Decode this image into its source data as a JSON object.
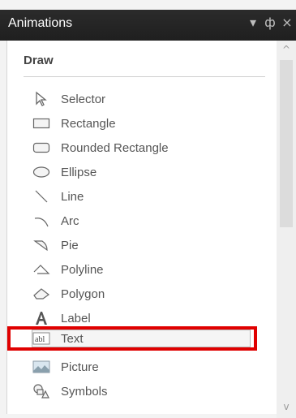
{
  "window": {
    "title": "Animations",
    "controls": {
      "dropdown": "▾",
      "pin": "ф",
      "close": "×"
    }
  },
  "section": {
    "title": "Draw"
  },
  "items": [
    {
      "label": "Selector",
      "icon": "cursor-arrow-icon"
    },
    {
      "label": "Rectangle",
      "icon": "rectangle-icon"
    },
    {
      "label": "Rounded Rectangle",
      "icon": "rounded-rectangle-icon"
    },
    {
      "label": "Ellipse",
      "icon": "ellipse-icon"
    },
    {
      "label": "Line",
      "icon": "line-icon"
    },
    {
      "label": "Arc",
      "icon": "arc-icon"
    },
    {
      "label": "Pie",
      "icon": "pie-icon"
    },
    {
      "label": "Polyline",
      "icon": "polyline-icon"
    },
    {
      "label": "Polygon",
      "icon": "polygon-icon"
    },
    {
      "label": "Label",
      "icon": "label-a-icon"
    },
    {
      "label": "Text",
      "icon": "textbox-icon",
      "selected": true
    },
    {
      "label": "Picture",
      "icon": "picture-icon"
    },
    {
      "label": "Symbols",
      "icon": "symbols-icon"
    }
  ],
  "scrollbar": {
    "up": "^",
    "down": "v"
  },
  "colors": {
    "titlebar": "#1f1f1f",
    "highlight": "#e00000"
  }
}
